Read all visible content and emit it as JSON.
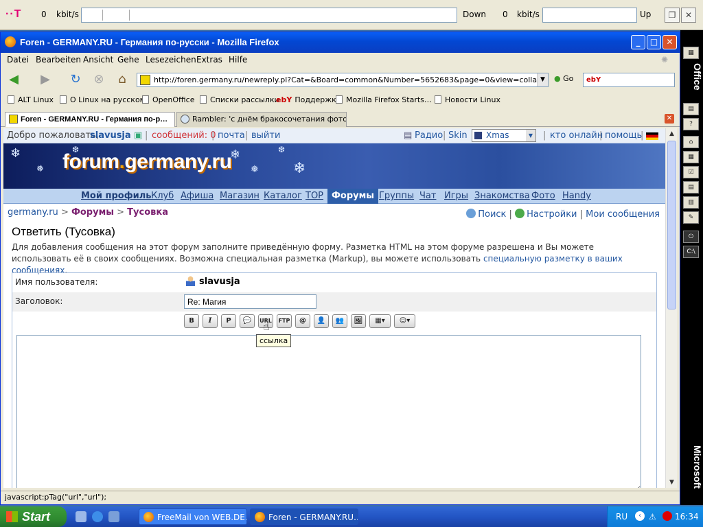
{
  "netmeter": {
    "down_value": "0",
    "down_unit": "kbit/s",
    "down_label": "Down",
    "up_value": "0",
    "up_unit": "kbit/s",
    "up_label": "Up"
  },
  "window": {
    "title": "Foren - GERMANY.RU - Германия по-русски - Mozilla Firefox",
    "controls": {
      "minimize": "_",
      "maximize": "□",
      "close": "✕"
    }
  },
  "menu": [
    "Datei",
    "Bearbeiten",
    "Ansicht",
    "Gehe",
    "Lesezeichen",
    "Extras",
    "Hilfe"
  ],
  "nav": {
    "url": "http://foren.germany.ru/newreply.pl?Cat=&Board=common&Number=5652683&page=0&view=collapsed&what=s",
    "go_label": "Go",
    "search_engine": "ebY"
  },
  "bookmarks": [
    "ALT Linux",
    "O Linux на русском",
    "OpenOffice",
    "Списки рассылки",
    "Поддержка",
    "Mozilla Firefox Starts…",
    "Новости Linux"
  ],
  "tabs": [
    {
      "label": "Foren - GERMANY.RU - Германия по-р…",
      "active": true
    },
    {
      "label": "Rambler: 'с днём бракосочетания фото' (…",
      "active": false
    }
  ],
  "welcome": {
    "greeting": "Добро пожаловать,",
    "username": "slavusja",
    "messages": "сообщений: 0",
    "mail": "почта",
    "logout": "выйти",
    "radio": "Радио",
    "skin": "Skin",
    "skin_value": "Xmas",
    "online": "кто онлайн",
    "help": "помощь"
  },
  "banner": {
    "brand_a": "forum",
    "brand_dot": ".",
    "brand_b": "germany.ru"
  },
  "mainnav": [
    {
      "label": "Мой профиль",
      "style": "bold"
    },
    {
      "label": "Клуб",
      "style": ""
    },
    {
      "label": "Афиша",
      "style": ""
    },
    {
      "label": "Магазин",
      "style": ""
    },
    {
      "label": "Каталог",
      "style": ""
    },
    {
      "label": "TOP",
      "style": ""
    },
    {
      "label": "Форумы",
      "style": "active"
    },
    {
      "label": "Группы",
      "style": ""
    },
    {
      "label": "Чат",
      "style": ""
    },
    {
      "label": "Игры",
      "style": ""
    },
    {
      "label": "Знакомства",
      "style": ""
    },
    {
      "label": "Фото",
      "style": ""
    },
    {
      "label": "Handy",
      "style": ""
    }
  ],
  "breadcrumb": {
    "site": "germany.ru",
    "sep": ">",
    "forums": "Форумы",
    "board": "Тусовка"
  },
  "rightlinks": {
    "search": "Поиск",
    "settings": "Настройки",
    "my_messages": "Мои сообщения"
  },
  "page": {
    "heading": "Ответить (Тусовка)",
    "description": "Для добавления сообщения на этот форум заполните приведённую форму. Разметка HTML на этом форуме разрешена и Вы можете использовать её в своих сообщениях. Возможна специальная разметка (Markup), вы можете использовать",
    "description_link": "специальную разметку в ваших сообщениях",
    "description_end": "."
  },
  "form": {
    "username_label": "Имя пользователя:",
    "username_value": "slavusja",
    "subject_label": "Заголовок:",
    "subject_value": "Re: Магия",
    "toolbar": [
      "B",
      "I",
      "P",
      "💬",
      "URL",
      "FTP",
      "@",
      "👤",
      "👥",
      "🖼",
      "▦▾",
      "☺▾"
    ],
    "tooltip": "ссылка"
  },
  "statusbar": "javascript:pTag(\"url\",\"url\");",
  "officebar": {
    "word_top": "Office",
    "word_bottom": "Microsoft"
  },
  "taskbar": {
    "start": "Start",
    "items": [
      {
        "label": "FreeMail von WEB.DE…",
        "active": false
      },
      {
        "label": "Foren - GERMANY.RU…",
        "active": true
      }
    ],
    "lang": "RU",
    "clock": "16:34"
  }
}
